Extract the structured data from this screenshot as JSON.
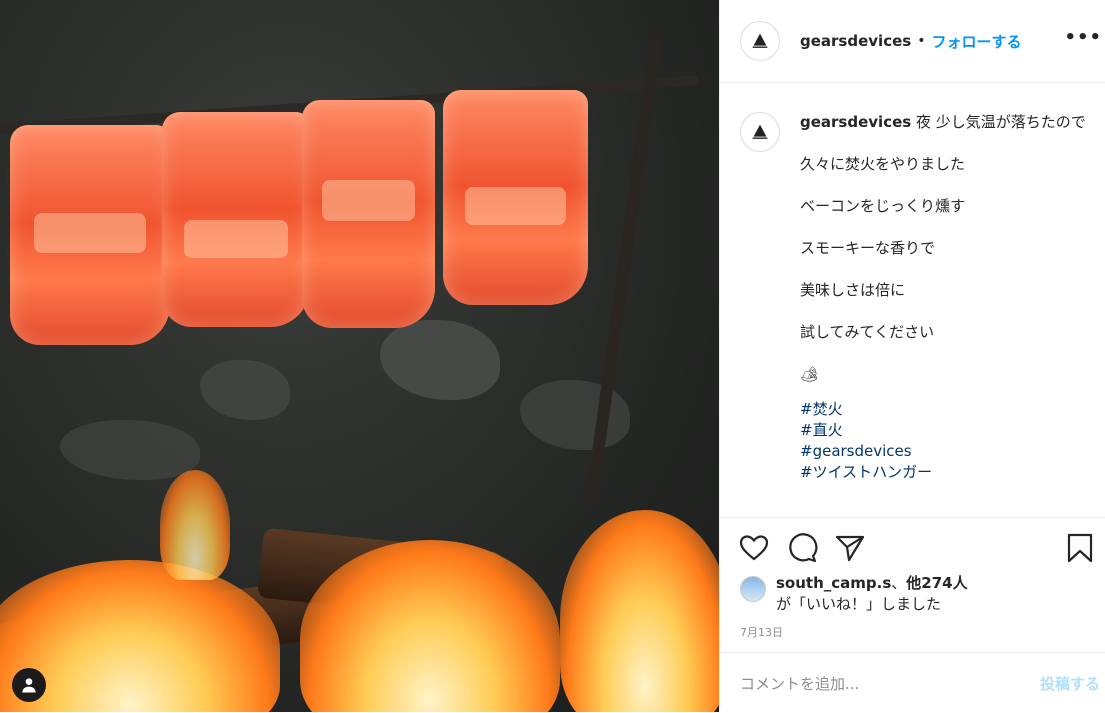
{
  "header": {
    "username": "gearsdevices",
    "separator": "•",
    "follow_label": "フォローする",
    "more_label": "•••"
  },
  "caption": {
    "username": "gearsdevices",
    "first_line": "夜 少し気温が落ちたので",
    "lines": [
      "久々に焚火をやりました",
      "ベーコンをじっくり燻す",
      "スモーキーな香りで",
      "美味しさは倍に",
      "試してみてください"
    ],
    "emoji": "🏕",
    "hashtags": [
      "#焚火",
      "#直火",
      "#gearsdevices",
      "#ツイストハンガー"
    ]
  },
  "likes": {
    "user": "south_camp.s",
    "separator": "、",
    "others": "他274人",
    "suffix": "が「いいね！」しました"
  },
  "date": "7月13日",
  "comment": {
    "placeholder": "コメントを追加...",
    "post_label": "投稿する"
  },
  "icons": [
    "heart-icon",
    "comment-icon",
    "share-icon",
    "bookmark-icon",
    "more-icon",
    "user-icon"
  ]
}
